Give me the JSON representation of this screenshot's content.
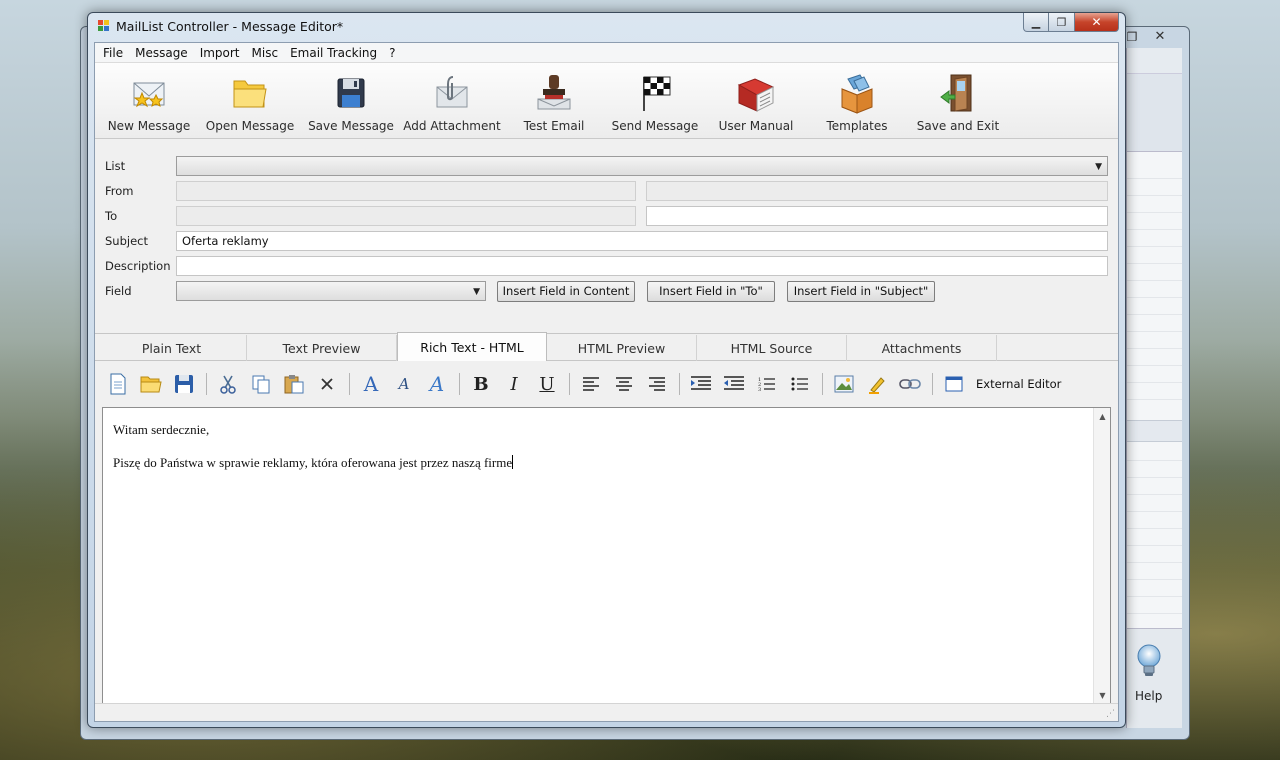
{
  "window": {
    "title": "MailList Controller - Message Editor*",
    "min_glyph": "▁",
    "max_glyph": "❐",
    "close_glyph": "✕"
  },
  "background_window": {
    "close_glyph": "✕",
    "restore_glyph": "❐",
    "help_label": "Help"
  },
  "menu": [
    "File",
    "Message",
    "Import",
    "Misc",
    "Email Tracking",
    "?"
  ],
  "toolbar": [
    {
      "label": "New Message",
      "icon": "new-message-icon"
    },
    {
      "label": "Open Message",
      "icon": "open-folder-icon"
    },
    {
      "label": "Save Message",
      "icon": "floppy-disk-icon"
    },
    {
      "label": "Add Attachment",
      "icon": "paperclip-envelope-icon"
    },
    {
      "label": "Test Email",
      "icon": "stamp-icon"
    },
    {
      "label": "Send Message",
      "icon": "checkered-flag-icon"
    },
    {
      "label": "User Manual",
      "icon": "book-icon"
    },
    {
      "label": "Templates",
      "icon": "box-icon"
    },
    {
      "label": "Save and Exit",
      "icon": "exit-door-icon"
    }
  ],
  "form": {
    "list_label": "List",
    "list_value": "",
    "from_label": "From",
    "from_name": "",
    "from_email": "",
    "to_label": "To",
    "to_name": "",
    "to_email": "",
    "subject_label": "Subject",
    "subject_value": "Oferta reklamy",
    "description_label": "Description",
    "description_value": "",
    "field_label": "Field",
    "field_value": "",
    "insert_content_btn": "Insert Field in Content",
    "insert_to_btn": "Insert Field in \"To\"",
    "insert_subject_btn": "Insert Field in \"Subject\""
  },
  "tabs": [
    {
      "label": "Plain Text",
      "active": false
    },
    {
      "label": "Text Preview",
      "active": false
    },
    {
      "label": "Rich Text - HTML",
      "active": true
    },
    {
      "label": "HTML Preview",
      "active": false
    },
    {
      "label": "HTML Source",
      "active": false
    },
    {
      "label": "Attachments",
      "active": false
    }
  ],
  "format_toolbar": {
    "bold": "B",
    "italic": "I",
    "underline": "U",
    "external_editor": "External Editor"
  },
  "editor": {
    "line1": "Witam serdecznie,",
    "line2": "Piszę do Państwa w sprawie reklamy, która oferowana jest przez naszą firme"
  },
  "colors": {
    "accent": "#3a78c8",
    "close_red": "#c6442a"
  }
}
